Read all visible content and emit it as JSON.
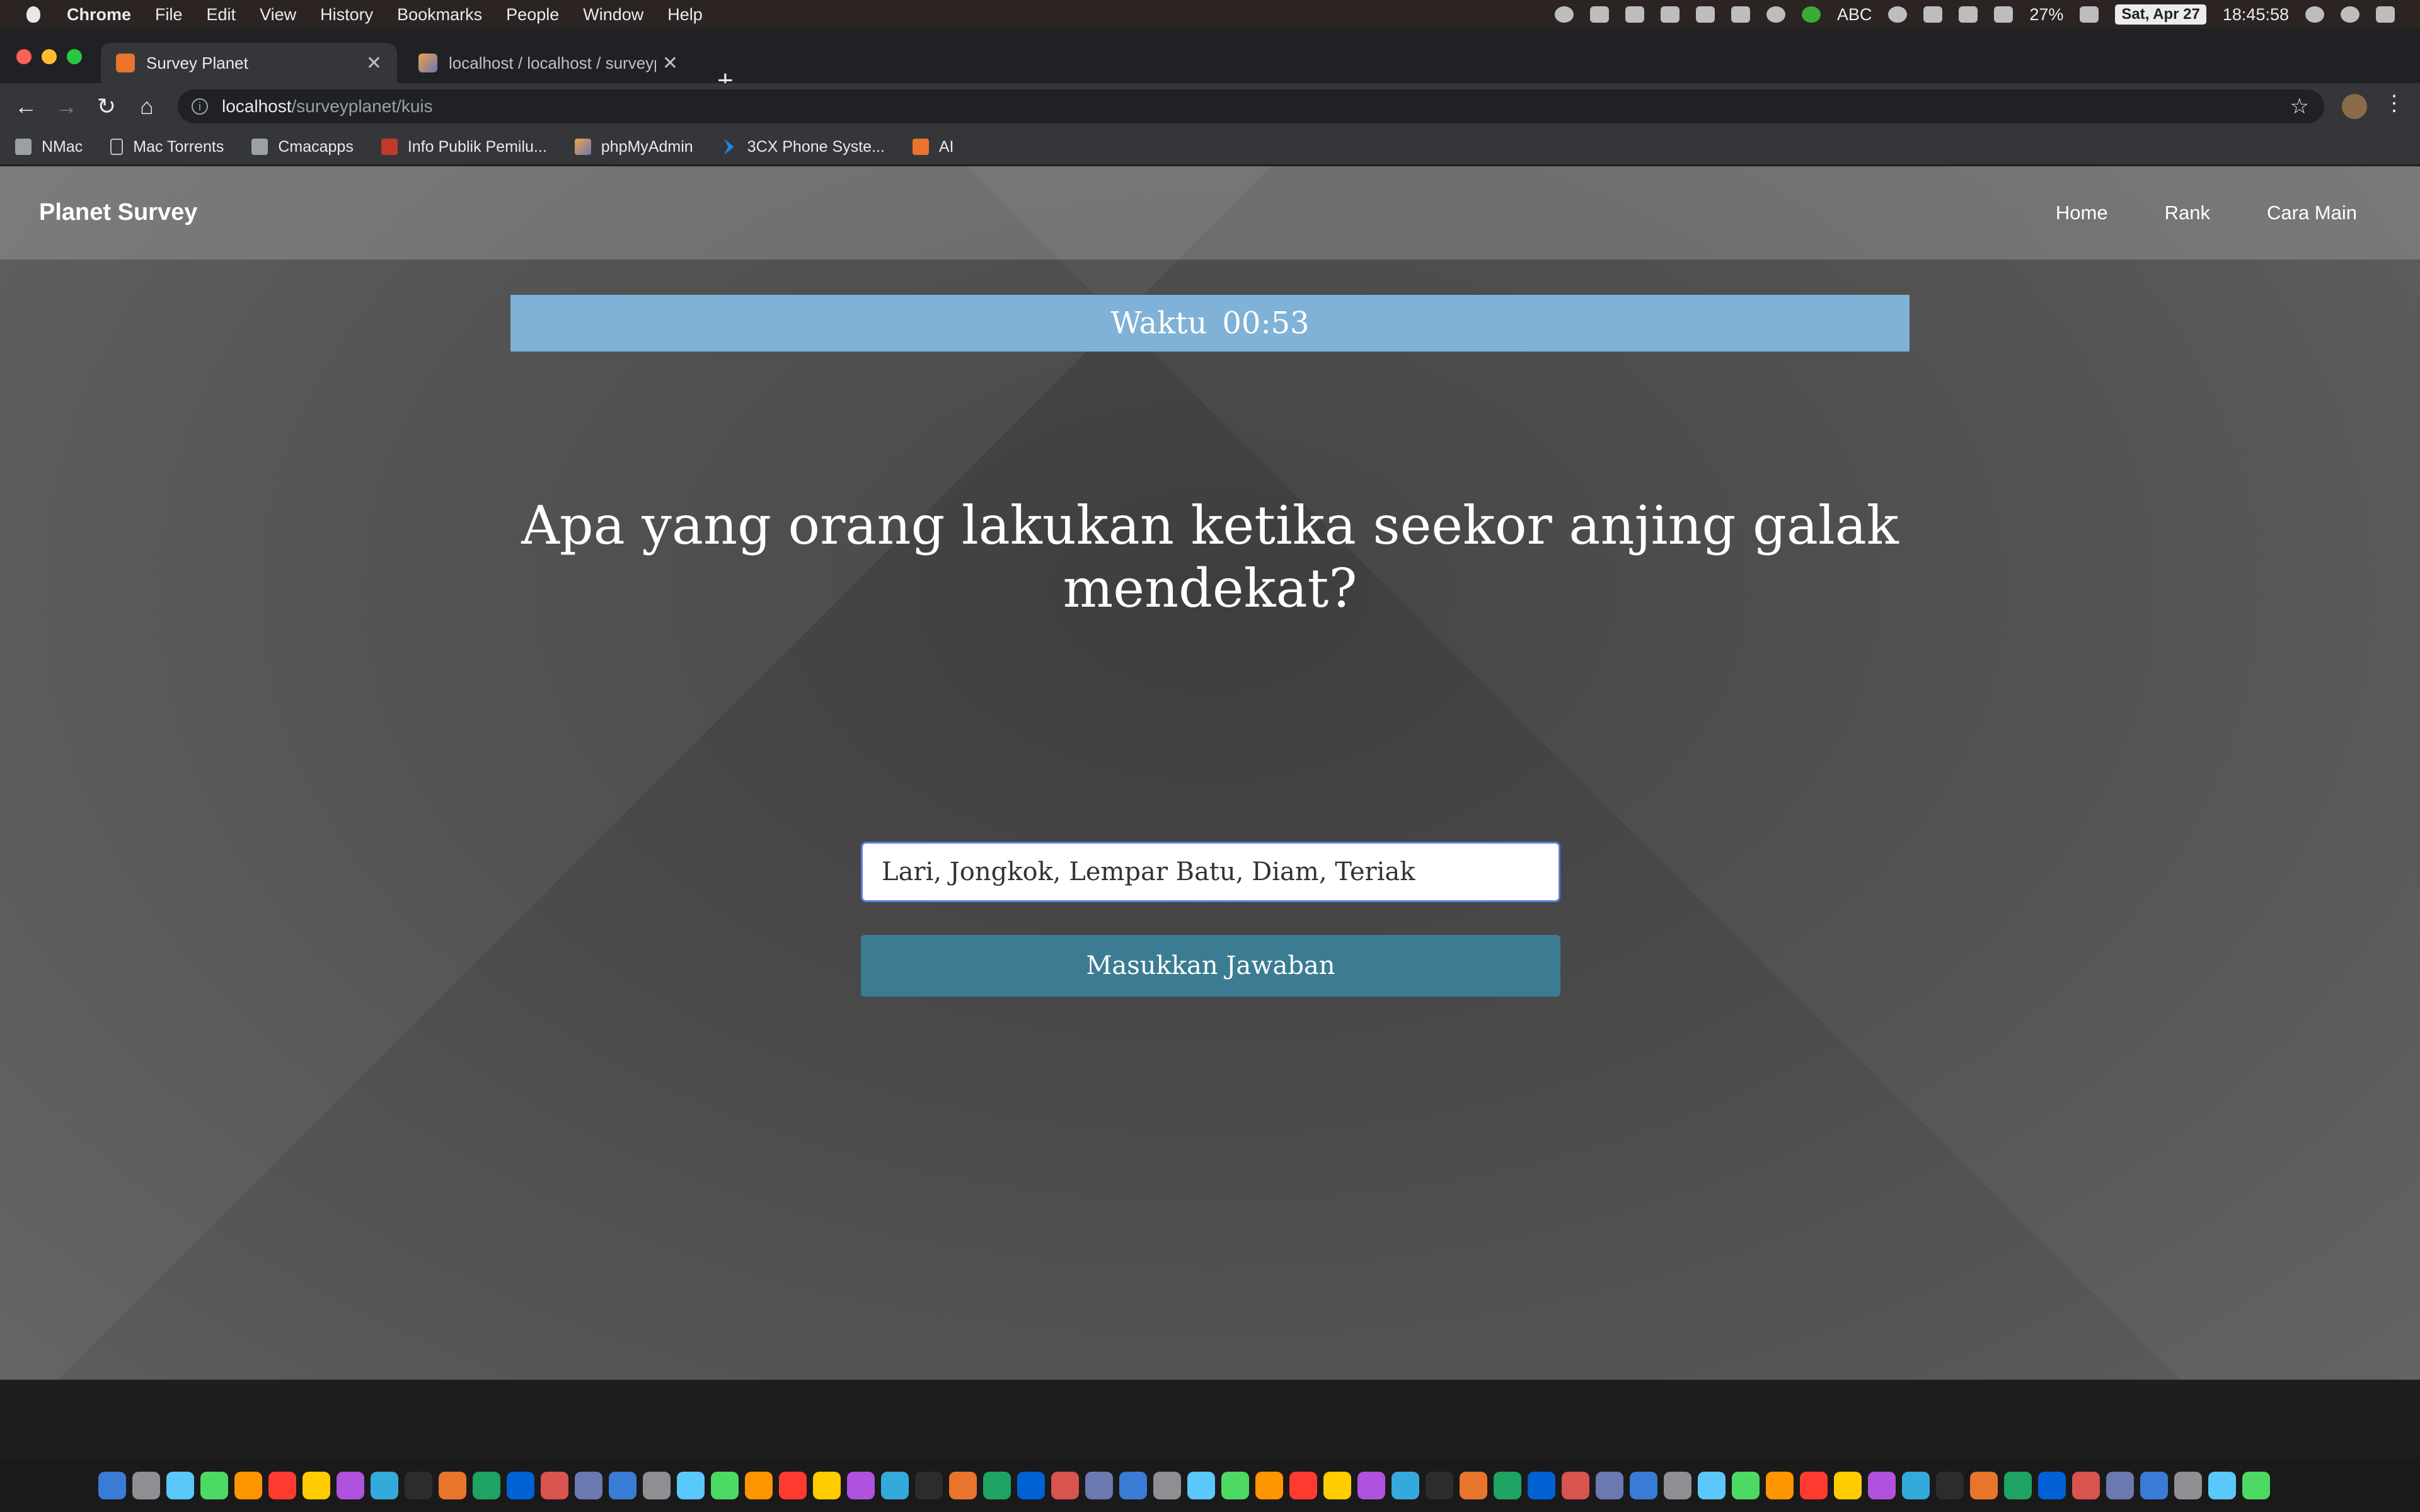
{
  "menubar": {
    "app_name": "Chrome",
    "items": [
      "File",
      "Edit",
      "View",
      "History",
      "Bookmarks",
      "People",
      "Window",
      "Help"
    ],
    "input_source": "ABC",
    "battery": "27%",
    "date": "Sat, Apr 27",
    "time": "18:45:58"
  },
  "tabs": [
    {
      "title": "Survey Planet",
      "active": true
    },
    {
      "title": "localhost / localhost / surveyplanet",
      "active": false
    }
  ],
  "toolbar": {
    "url_host": "localhost",
    "url_path": "/surveyplanet/kuis"
  },
  "bookmarks": [
    "NMac",
    "Mac Torrents",
    "Cmacapps",
    "Info Publik Pemilu...",
    "phpMyAdmin",
    "3CX Phone Syste...",
    "AI"
  ],
  "page": {
    "brand": "Planet Survey",
    "nav": [
      "Home",
      "Rank",
      "Cara Main"
    ],
    "timer_label": "Waktu",
    "timer_value": "00:53",
    "question": "Apa yang orang lakukan ketika seekor anjing galak mendekat?",
    "answer_value": "Lari, Jongkok, Lempar Batu, Diam, Teriak",
    "submit_label": "Masukkan Jawaban"
  },
  "colors": {
    "timer_bar": "#7fb2d6",
    "submit_button": "#3b7c93",
    "input_border": "#5b7fd6"
  }
}
